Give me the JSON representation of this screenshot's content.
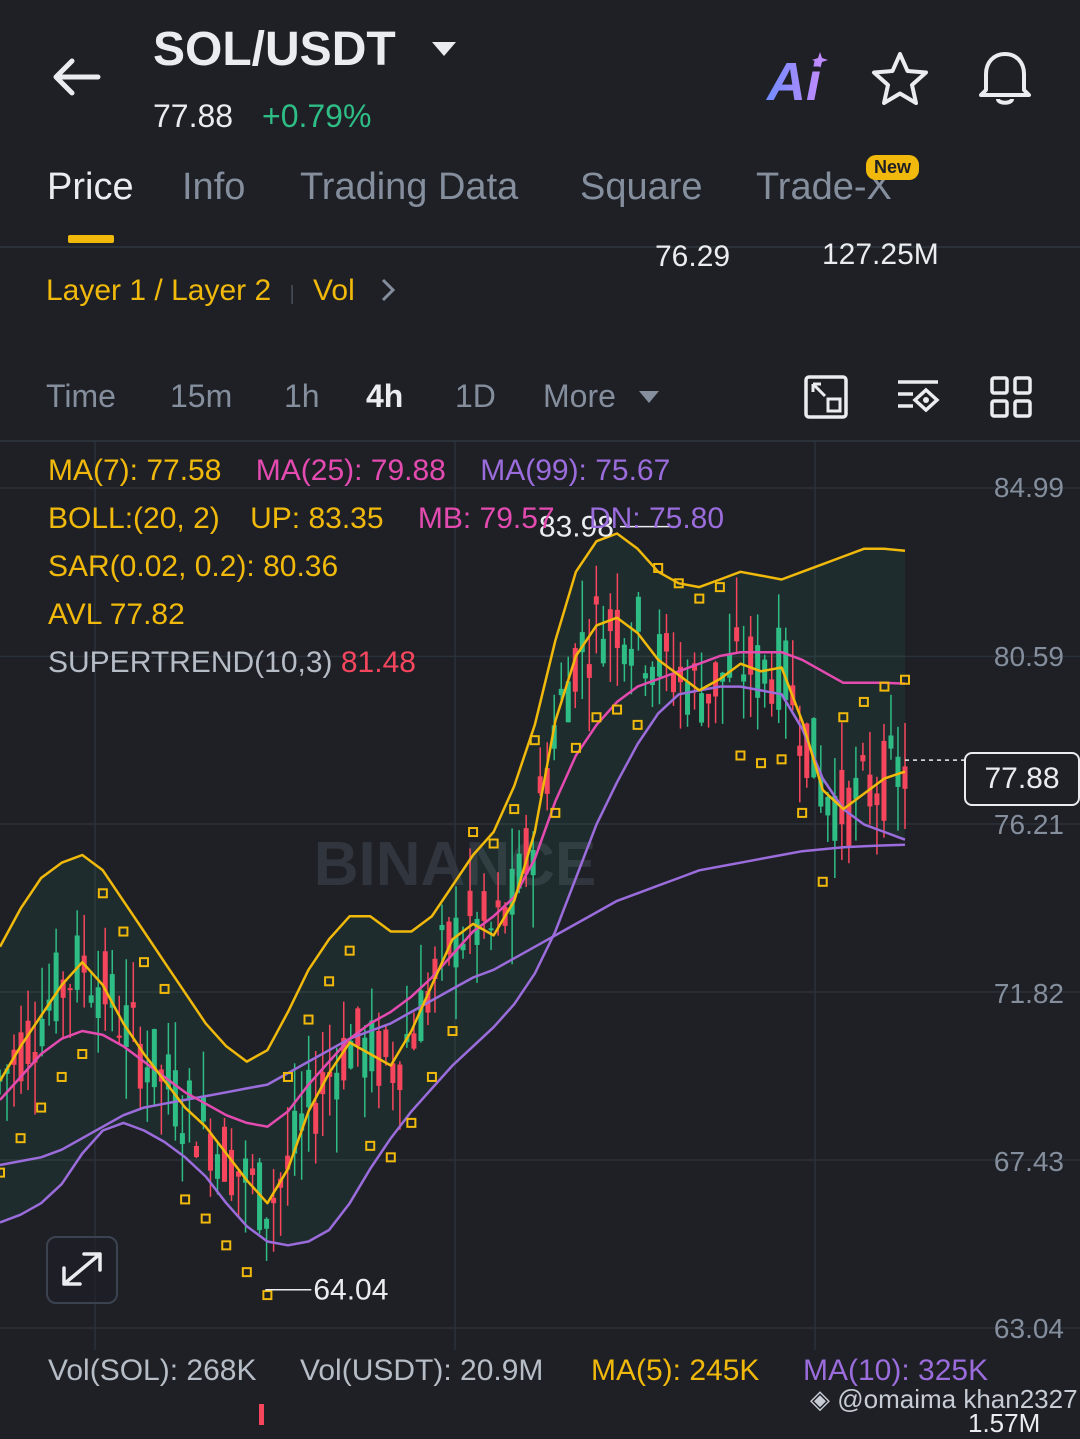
{
  "header": {
    "pair": "SOL/USDT",
    "price": "77.88",
    "change": "+0.79%",
    "ai_label": "Ai"
  },
  "tabs": [
    {
      "label": "Price",
      "active": true
    },
    {
      "label": "Info"
    },
    {
      "label": "Trading Data"
    },
    {
      "label": "Square"
    },
    {
      "label": "Trade-X",
      "badge": "New"
    }
  ],
  "partial_stats": {
    "low": "76.29",
    "vol": "127.25M"
  },
  "tags": {
    "category": "Layer 1 / Layer 2",
    "sub": "Vol"
  },
  "intervals": [
    {
      "label": "Time"
    },
    {
      "label": "15m"
    },
    {
      "label": "1h"
    },
    {
      "label": "4h",
      "active": true
    },
    {
      "label": "1D"
    },
    {
      "label": "More"
    }
  ],
  "indicators": {
    "ma7": "MA(7): 77.58",
    "ma25": "MA(25): 79.88",
    "ma99": "MA(99): 75.67",
    "boll": "BOLL:(20, 2)",
    "boll_up": "UP: 83.35",
    "boll_mb": "MB: 79.57",
    "boll_dn": "DN: 75.80",
    "sar": "SAR(0.02, 0.2): 80.36",
    "avl": "AVL 77.82",
    "supertrend_label": "SUPERTREND(10,3)",
    "supertrend_value": "81.48"
  },
  "price_axis": [
    "84.99",
    "80.59",
    "76.21",
    "71.82",
    "67.43",
    "63.04"
  ],
  "current_price_tag": "77.88",
  "high_marker": "83.98",
  "low_marker": "64.04",
  "watermark": "BINANCE",
  "volume": {
    "sol": "Vol(SOL): 268K",
    "usdt": "Vol(USDT): 20.9M",
    "ma5": "MA(5): 245K",
    "ma10": "MA(10): 325K"
  },
  "partial_bottom": "1.57M",
  "credit": "@omaima khan2327",
  "colors": {
    "background": "#1e2026",
    "accent": "#f0b90b",
    "up": "#2ebd85",
    "down": "#f6465d",
    "ma25": "#e44bb0",
    "ma99": "#9b6cdb"
  },
  "chart_data": {
    "type": "candlestick",
    "y_range": [
      63.04,
      84.99
    ],
    "high": 83.98,
    "low": 64.04,
    "last": 77.88,
    "ma7": [
      69.5,
      70.4,
      71.2,
      72.0,
      72.6,
      72.0,
      71.0,
      70.2,
      69.5,
      68.8,
      68.3,
      67.6,
      66.9,
      66.3,
      67.2,
      68.7,
      69.7,
      70.5,
      70.2,
      69.9,
      70.8,
      72.0,
      73.2,
      73.6,
      73.3,
      74.2,
      76.0,
      78.9,
      80.6,
      81.4,
      81.6,
      81.2,
      80.5,
      80.1,
      79.7,
      80.0,
      80.4,
      80.2,
      80.3,
      78.9,
      77.1,
      76.6,
      77.0,
      77.4,
      77.58
    ],
    "ma25": [
      69.0,
      69.6,
      70.2,
      70.6,
      70.8,
      70.7,
      70.4,
      70.0,
      69.6,
      69.2,
      68.9,
      68.6,
      68.4,
      68.3,
      68.7,
      69.4,
      70.0,
      70.6,
      71.0,
      71.3,
      71.7,
      72.2,
      72.8,
      73.4,
      73.8,
      74.3,
      75.3,
      76.8,
      78.0,
      78.8,
      79.4,
      79.8,
      80.0,
      80.2,
      80.4,
      80.6,
      80.7,
      80.7,
      80.7,
      80.5,
      80.2,
      79.9,
      79.9,
      79.9,
      79.88
    ],
    "ma99": [
      67.3,
      67.4,
      67.5,
      67.7,
      68.0,
      68.3,
      68.6,
      68.8,
      68.9,
      69.0,
      69.1,
      69.2,
      69.3,
      69.4,
      69.7,
      70.0,
      70.3,
      70.6,
      70.8,
      71.0,
      71.3,
      71.6,
      71.9,
      72.2,
      72.4,
      72.7,
      73.0,
      73.3,
      73.6,
      73.9,
      74.2,
      74.4,
      74.6,
      74.8,
      75.0,
      75.1,
      75.2,
      75.3,
      75.4,
      75.5,
      75.55,
      75.6,
      75.63,
      75.65,
      75.67
    ],
    "boll_up": [
      73.0,
      74.0,
      74.8,
      75.2,
      75.4,
      75.0,
      74.2,
      73.4,
      72.6,
      71.8,
      71.0,
      70.4,
      70.0,
      70.3,
      71.3,
      72.4,
      73.2,
      73.8,
      73.8,
      73.4,
      73.4,
      73.8,
      74.6,
      75.4,
      76.0,
      77.2,
      78.8,
      81.0,
      82.8,
      83.6,
      83.8,
      83.4,
      82.8,
      82.5,
      82.4,
      82.6,
      82.8,
      82.7,
      82.6,
      82.8,
      83.0,
      83.2,
      83.4,
      83.4,
      83.35
    ],
    "boll_dn": [
      65.8,
      66.0,
      66.3,
      66.8,
      67.6,
      68.2,
      68.4,
      68.2,
      67.9,
      67.5,
      67.0,
      66.3,
      65.7,
      65.3,
      65.2,
      65.3,
      65.6,
      66.3,
      67.2,
      68.0,
      68.7,
      69.3,
      69.9,
      70.4,
      70.9,
      71.5,
      72.3,
      73.4,
      74.8,
      76.2,
      77.3,
      78.3,
      79.1,
      79.6,
      79.7,
      79.8,
      79.8,
      79.7,
      79.6,
      78.7,
      77.4,
      76.6,
      76.2,
      76.0,
      75.8
    ]
  }
}
